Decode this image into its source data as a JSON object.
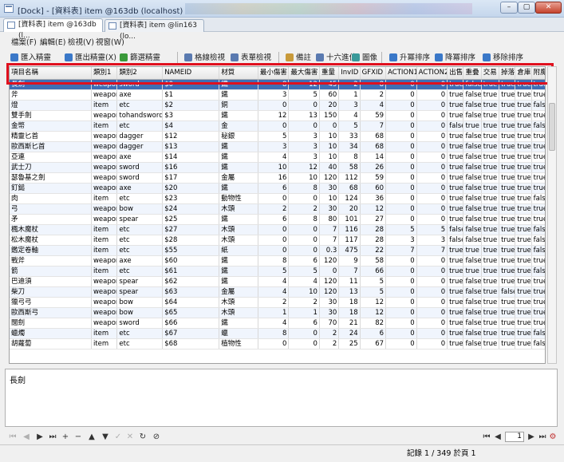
{
  "window": {
    "title": "[Dock] - [資料表] item @163db (localhost)",
    "min_glyph": "–",
    "max_glyph": "▢",
    "close_glyph": "✕"
  },
  "tabs": [
    {
      "label": "[資料表] item @163db (l..."
    },
    {
      "label": "[資料表] item @lin163 (lo..."
    }
  ],
  "menu": [
    {
      "label": "檔案(F)"
    },
    {
      "label": "編輯(E)"
    },
    {
      "label": "檢視(V)"
    },
    {
      "label": "視窗(W)"
    }
  ],
  "toolbar": [
    {
      "label": "匯入精靈",
      "icon": "import-icon",
      "color": "#3a78c8"
    },
    {
      "label": "匯出精靈(X)",
      "icon": "export-icon",
      "color": "#3a78c8"
    },
    {
      "label": "篩選精靈",
      "icon": "filter-icon",
      "color": "#3a9a3a"
    },
    {
      "label": "格線檢視",
      "icon": "grid-view-icon",
      "color": "#5a7ab0"
    },
    {
      "label": "表單檢視",
      "icon": "form-view-icon",
      "color": "#5a7ab0"
    },
    {
      "label": "備註",
      "icon": "memo-icon",
      "color": "#c89a3a"
    },
    {
      "label": "十六進位",
      "icon": "hex-icon",
      "color": "#5a7ab0"
    },
    {
      "label": "圖像",
      "icon": "image-icon",
      "color": "#3a9a9a"
    },
    {
      "label": "升冪排序",
      "icon": "sort-ascending-icon",
      "color": "#3a78c8"
    },
    {
      "label": "降冪排序",
      "icon": "sort-descending-icon",
      "color": "#3a78c8"
    },
    {
      "label": "移除排序",
      "icon": "remove-sort-icon",
      "color": "#3a78c8"
    }
  ],
  "columns": [
    "項目名稱",
    "類別1",
    "類別2",
    "NAMEID",
    "材質",
    "最小傷害",
    "最大傷害",
    "重量",
    "InvID",
    "GFXID",
    "ACTION1",
    "ACTION2",
    "出售",
    "重疊",
    "交易",
    "掉落",
    "倉庫",
    "附魔"
  ],
  "rows": [
    [
      "長劍",
      "weapon",
      "sword",
      "$0",
      "鐵",
      "8",
      "12",
      "45",
      "2",
      "8",
      "0",
      "0",
      "true",
      "false",
      "true",
      "true",
      "true",
      "true"
    ],
    [
      "斧",
      "weapon",
      "axe",
      "$1",
      "鐵",
      "3",
      "5",
      "60",
      "1",
      "2",
      "0",
      "0",
      "true",
      "false",
      "true",
      "true",
      "true",
      "true"
    ],
    [
      "燈",
      "item",
      "etc",
      "$2",
      "銅",
      "0",
      "0",
      "20",
      "3",
      "4",
      "0",
      "0",
      "true",
      "false",
      "true",
      "true",
      "true",
      "false"
    ],
    [
      "雙手劍",
      "weapon",
      "tohandsword",
      "$3",
      "鐵",
      "12",
      "13",
      "150",
      "4",
      "59",
      "0",
      "0",
      "true",
      "false",
      "true",
      "true",
      "true",
      "true"
    ],
    [
      "金幣",
      "item",
      "etc",
      "$4",
      "金",
      "0",
      "0",
      "0",
      "5",
      "7",
      "0",
      "0",
      "false",
      "true",
      "true",
      "true",
      "true",
      "false"
    ],
    [
      "精靈匕首",
      "weapon",
      "dagger",
      "$12",
      "秘銀",
      "5",
      "3",
      "10",
      "33",
      "68",
      "0",
      "0",
      "true",
      "false",
      "true",
      "true",
      "true",
      "true"
    ],
    [
      "歐西斯匕首",
      "weapon",
      "dagger",
      "$13",
      "鐵",
      "3",
      "3",
      "10",
      "34",
      "68",
      "0",
      "0",
      "true",
      "false",
      "true",
      "true",
      "true",
      "true"
    ],
    [
      "亞連",
      "weapon",
      "axe",
      "$14",
      "鐵",
      "4",
      "3",
      "10",
      "8",
      "14",
      "0",
      "0",
      "true",
      "false",
      "true",
      "true",
      "true",
      "true"
    ],
    [
      "武士刀",
      "weapon",
      "sword",
      "$16",
      "鐵",
      "10",
      "12",
      "40",
      "58",
      "26",
      "0",
      "0",
      "true",
      "false",
      "true",
      "true",
      "true",
      "true"
    ],
    [
      "瑟魯基之劍",
      "weapon",
      "sword",
      "$17",
      "金屬",
      "16",
      "10",
      "120",
      "112",
      "59",
      "0",
      "0",
      "true",
      "false",
      "true",
      "true",
      "true",
      "true"
    ],
    [
      "釘鎚",
      "weapon",
      "axe",
      "$20",
      "鐵",
      "6",
      "8",
      "30",
      "68",
      "60",
      "0",
      "0",
      "true",
      "false",
      "true",
      "true",
      "true",
      "true"
    ],
    [
      "肉",
      "item",
      "etc",
      "$23",
      "動物性",
      "0",
      "0",
      "10",
      "124",
      "36",
      "0",
      "0",
      "true",
      "false",
      "true",
      "true",
      "true",
      "false"
    ],
    [
      "弓",
      "weapon",
      "bow",
      "$24",
      "木頭",
      "2",
      "2",
      "30",
      "20",
      "12",
      "0",
      "0",
      "true",
      "false",
      "true",
      "true",
      "true",
      "true"
    ],
    [
      "矛",
      "weapon",
      "spear",
      "$25",
      "鐵",
      "6",
      "8",
      "80",
      "101",
      "27",
      "0",
      "0",
      "true",
      "false",
      "true",
      "true",
      "true",
      "true"
    ],
    [
      "楓木魔杖",
      "item",
      "etc",
      "$27",
      "木頭",
      "0",
      "0",
      "7",
      "116",
      "28",
      "5",
      "5",
      "false",
      "false",
      "true",
      "true",
      "true",
      "false"
    ],
    [
      "松木魔杖",
      "item",
      "etc",
      "$28",
      "木頭",
      "0",
      "0",
      "7",
      "117",
      "28",
      "3",
      "3",
      "false",
      "false",
      "true",
      "true",
      "true",
      "false"
    ],
    [
      "鑑定卷軸",
      "item",
      "etc",
      "$55",
      "紙",
      "0",
      "0",
      "0.3",
      "475",
      "22",
      "7",
      "7",
      "true",
      "true",
      "true",
      "true",
      "true",
      "false"
    ],
    [
      "戰斧",
      "weapon",
      "axe",
      "$60",
      "鐵",
      "8",
      "6",
      "120",
      "9",
      "58",
      "0",
      "0",
      "true",
      "false",
      "true",
      "true",
      "true",
      "true"
    ],
    [
      "箭",
      "item",
      "etc",
      "$61",
      "鐵",
      "5",
      "5",
      "0",
      "7",
      "66",
      "0",
      "0",
      "true",
      "true",
      "true",
      "true",
      "true",
      "false"
    ],
    [
      "巴迪須",
      "weapon",
      "spear",
      "$62",
      "鐵",
      "4",
      "4",
      "120",
      "11",
      "5",
      "0",
      "0",
      "true",
      "false",
      "true",
      "true",
      "true",
      "true"
    ],
    [
      "柴刀",
      "weapon",
      "spear",
      "$63",
      "金屬",
      "4",
      "10",
      "120",
      "13",
      "5",
      "0",
      "0",
      "true",
      "false",
      "true",
      "false",
      "true",
      "true"
    ],
    [
      "獵弓弓",
      "weapon",
      "bow",
      "$64",
      "木頭",
      "2",
      "2",
      "30",
      "18",
      "12",
      "0",
      "0",
      "true",
      "false",
      "true",
      "true",
      "true",
      "true"
    ],
    [
      "歐西斯弓",
      "weapon",
      "bow",
      "$65",
      "木頭",
      "1",
      "1",
      "30",
      "18",
      "12",
      "0",
      "0",
      "true",
      "false",
      "true",
      "true",
      "true",
      "true"
    ],
    [
      "闊劍",
      "weapon",
      "sword",
      "$66",
      "鐵",
      "4",
      "6",
      "70",
      "21",
      "82",
      "0",
      "0",
      "true",
      "false",
      "true",
      "true",
      "true",
      "true"
    ],
    [
      "蠟燭",
      "item",
      "etc",
      "$67",
      "蠟",
      "8",
      "0",
      "2",
      "24",
      "6",
      "0",
      "0",
      "true",
      "false",
      "true",
      "true",
      "true",
      "false"
    ],
    [
      "胡蘿蔔",
      "item",
      "etc",
      "$68",
      "植物性",
      "0",
      "0",
      "2",
      "25",
      "67",
      "0",
      "0",
      "true",
      "false",
      "true",
      "true",
      "true",
      "false"
    ]
  ],
  "detail": {
    "value": "長劍"
  },
  "navigator": {
    "page_value": "1",
    "status": "記錄 1 / 349 於頁 1"
  }
}
